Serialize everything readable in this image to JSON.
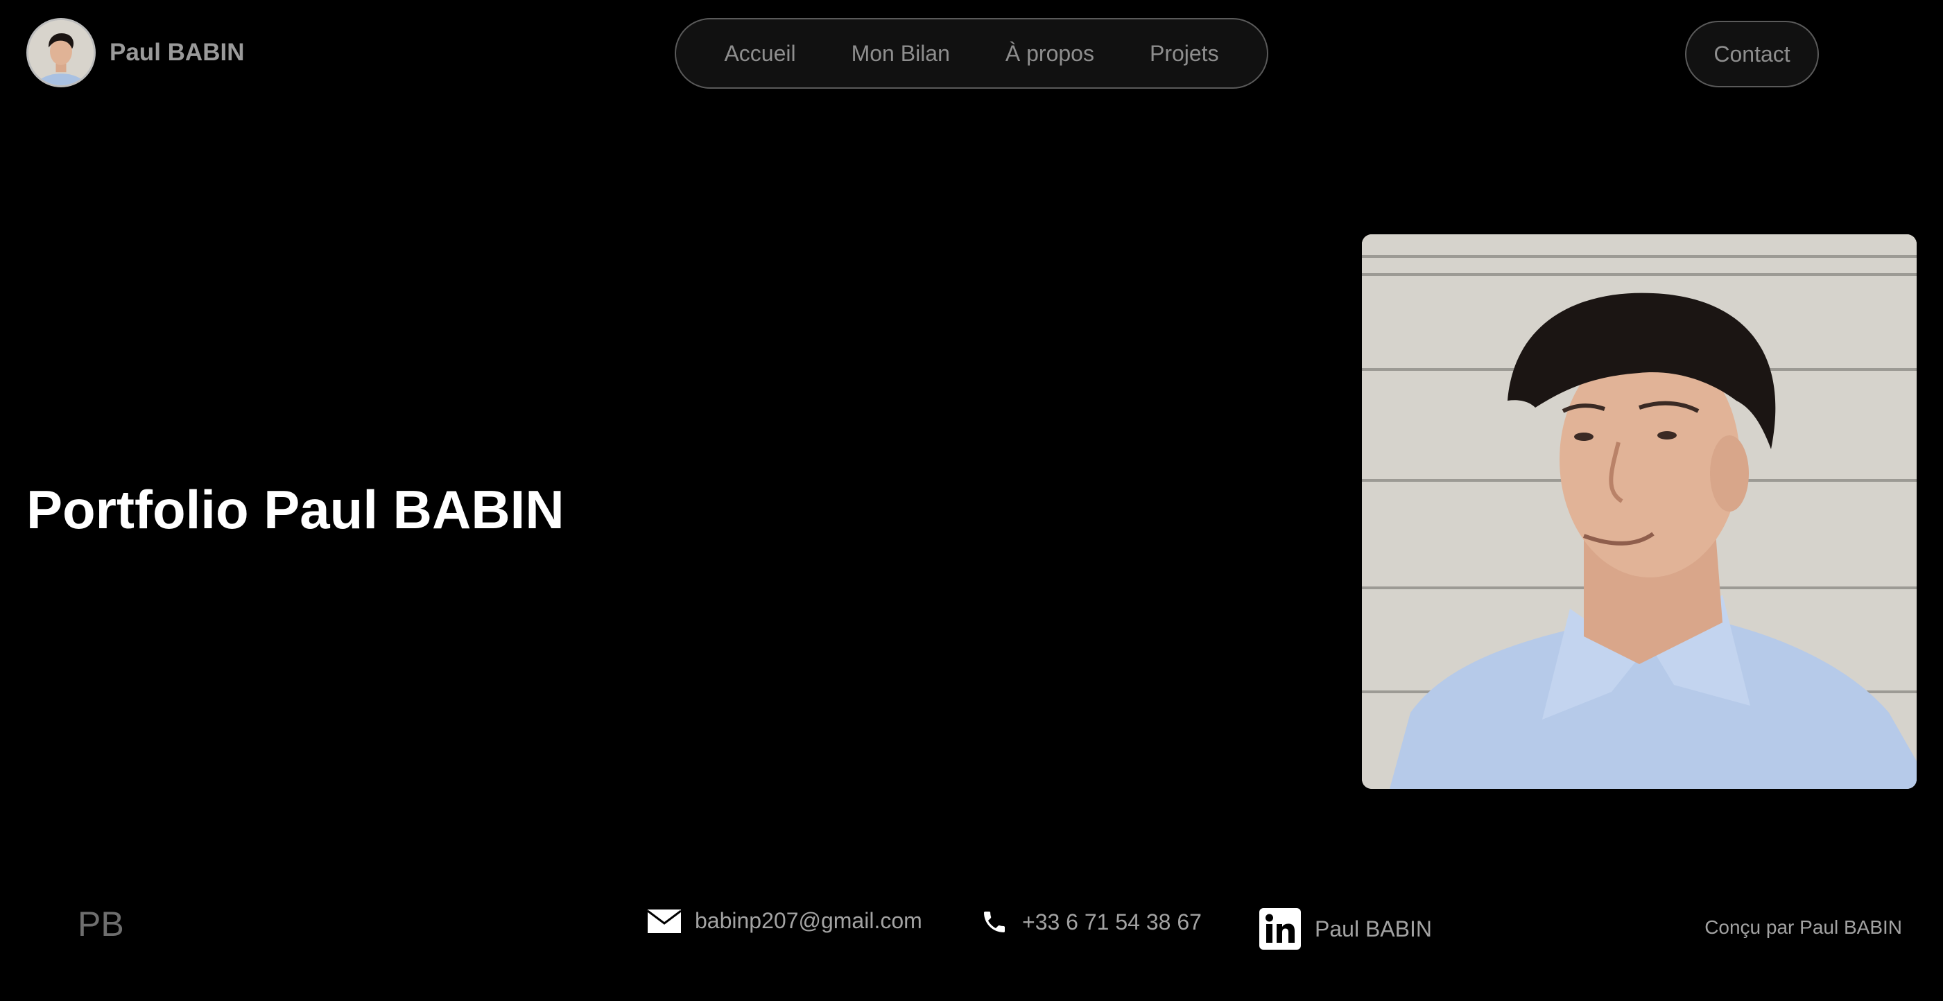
{
  "header": {
    "brand_name": "Paul BABIN",
    "nav": [
      {
        "label": "Accueil"
      },
      {
        "label": "Mon Bilan"
      },
      {
        "label": "À propos"
      },
      {
        "label": "Projets"
      }
    ],
    "contact_label": "Contact"
  },
  "hero": {
    "title": "Portfolio Paul BABIN"
  },
  "footer": {
    "monogram": "PB",
    "email": "babinp207@gmail.com",
    "phone": "+33 6 71 54 38 67",
    "linkedin": "Paul BABIN",
    "credit": "Conçu par Paul BABIN",
    "icons": {
      "email": "envelope-icon",
      "phone": "phone-icon",
      "linkedin": "linkedin-icon"
    }
  },
  "colors": {
    "background": "#000000",
    "text_primary": "#ffffff",
    "text_muted": "#8e8e8e",
    "pill_border": "#5a5a5a",
    "pill_background": "#111111"
  }
}
